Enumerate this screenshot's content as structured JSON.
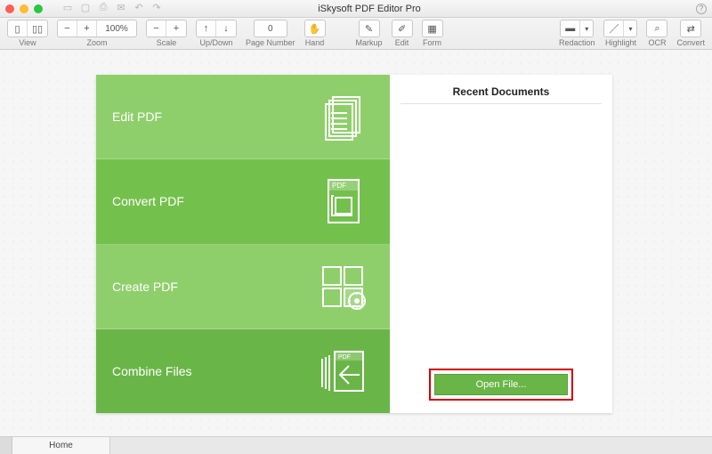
{
  "window": {
    "title": "iSkysoft PDF Editor Pro"
  },
  "quickbar_icons": [
    "folder",
    "save",
    "print",
    "mail",
    "undo",
    "redo"
  ],
  "toolbar": {
    "view_label": "View",
    "zoom_label": "Zoom",
    "zoom_value": "100%",
    "scale_label": "Scale",
    "updown_label": "Up/Down",
    "page_label": "Page Number",
    "page_value": "0",
    "hand_label": "Hand",
    "markup_label": "Markup",
    "edit_label": "Edit",
    "form_label": "Form",
    "redaction_label": "Redaction",
    "highlight_label": "Highlight",
    "ocr_label": "OCR",
    "convert_label": "Convert"
  },
  "start": {
    "tiles": {
      "edit": "Edit PDF",
      "convert": "Convert PDF",
      "create": "Create PDF",
      "combine": "Combine Files",
      "convert_badge": "PDF",
      "combine_badge": "PDF"
    },
    "recent_heading": "Recent Documents",
    "open_file_label": "Open File..."
  },
  "tabs": {
    "home": "Home"
  },
  "colors": {
    "tile_light": "#8fcf6b",
    "tile_mid": "#74c04d",
    "tile_dark": "#6ab547",
    "highlight": "#d40000"
  }
}
